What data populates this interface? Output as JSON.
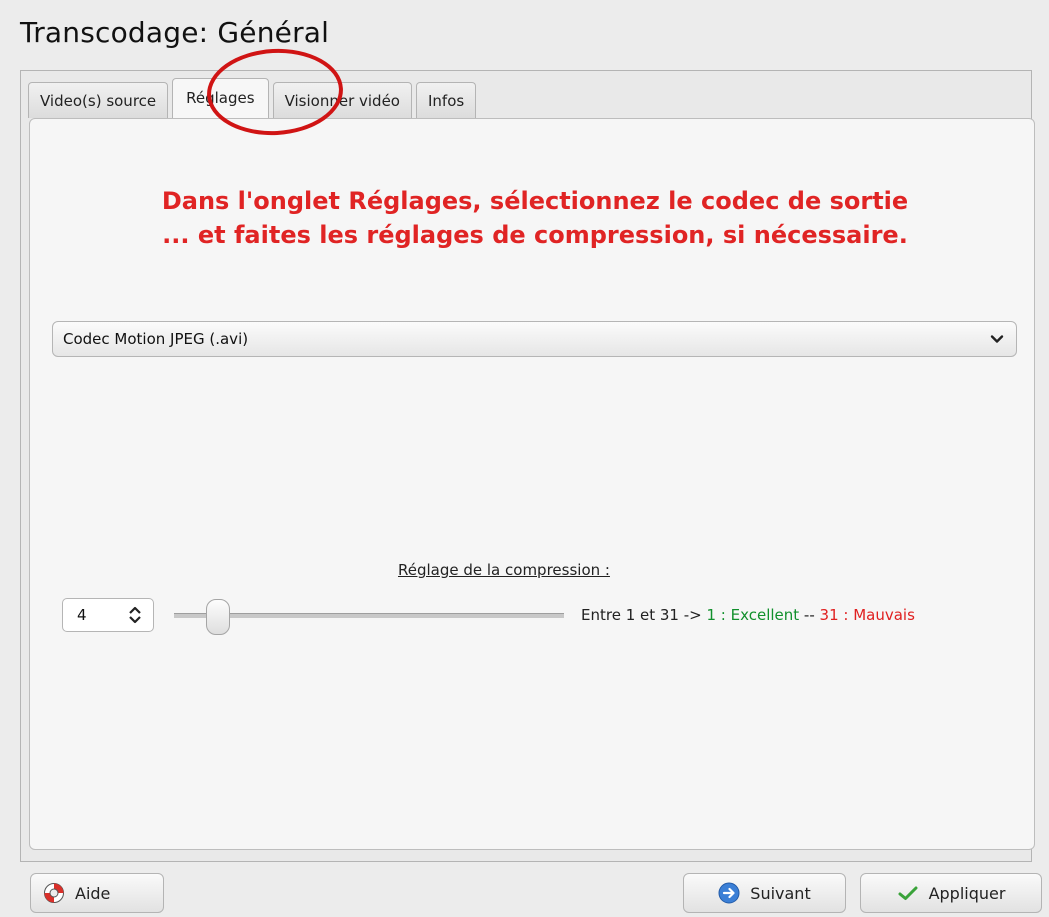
{
  "window": {
    "title": "Transcodage: Général"
  },
  "tabs": [
    {
      "label": "Video(s) source"
    },
    {
      "label": "Réglages"
    },
    {
      "label": "Visionner vidéo"
    },
    {
      "label": "Infos"
    }
  ],
  "active_tab": "Réglages",
  "instruction": {
    "line1": "Dans l'onglet Réglages, sélectionnez le codec de sortie",
    "line2": "... et faites les réglages de compression, si nécessaire."
  },
  "codec_select": {
    "selected": "Codec Motion JPEG (.avi)",
    "icon": "chevron-down-icon"
  },
  "compression": {
    "label": "Réglage de la compression :",
    "spin_value": "4",
    "slider_min": 1,
    "slider_max": 31,
    "slider_value": 4,
    "range_prefix": "Entre 1 et 31 -> ",
    "best_text": "1 : Excellent",
    "sep": " -- ",
    "worst_text": "31 : Mauvais"
  },
  "buttons": {
    "help": "Aide",
    "next": "Suivant",
    "apply": "Appliquer"
  },
  "colors": {
    "annotation_red": "#e02424",
    "excellent_green": "#11902c",
    "bad_red": "#e02020"
  }
}
